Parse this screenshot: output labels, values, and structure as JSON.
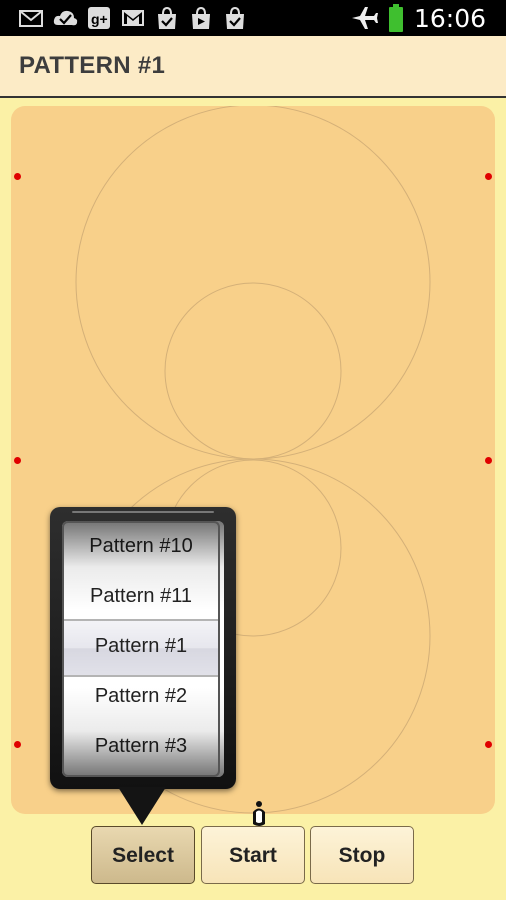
{
  "status_bar": {
    "time": "16:06",
    "notification_icons": [
      "mail-icon",
      "check-icon",
      "google-plus-icon",
      "gmail-icon",
      "store-icon",
      "play-store-icon",
      "store-icon"
    ],
    "right_icons": [
      "airplane-icon",
      "battery-icon"
    ],
    "battery_color": "#3fbf2f"
  },
  "action_bar": {
    "title": "PATTERN #1"
  },
  "picker": {
    "items": [
      "Pattern #10",
      "Pattern #11",
      "Pattern #1",
      "Pattern #2",
      "Pattern #3"
    ],
    "selected": "Pattern #1"
  },
  "buttons": {
    "select": "Select",
    "start": "Start",
    "stop": "Stop"
  },
  "colors": {
    "background": "#fbf1a6",
    "canvas": "#f8d08a",
    "action_bar": "#fcebc6",
    "marker": "#e00000"
  }
}
